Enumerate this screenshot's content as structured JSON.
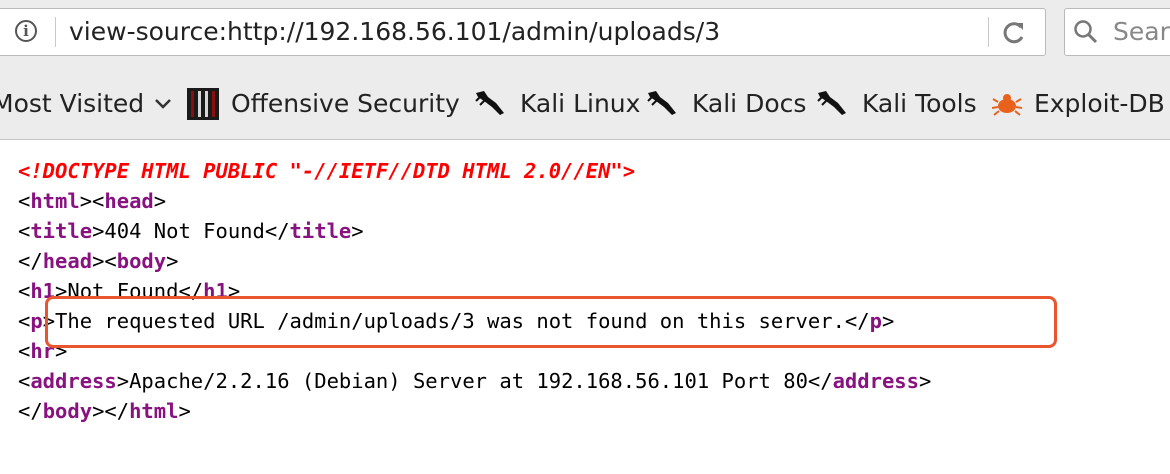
{
  "address_bar": {
    "url": "view-source:http://192.168.56.101/admin/uploads/3",
    "info_icon": "info-icon",
    "reload_icon": "reload-icon"
  },
  "search_bar": {
    "placeholder": "Sear",
    "icon": "search-icon"
  },
  "bookmarks": [
    {
      "label": "Most Visited",
      "icon": "chevron-down-icon"
    },
    {
      "label": "Offensive Security",
      "icon": "offsec-logo-icon"
    },
    {
      "label": "Kali Linux",
      "icon": "kali-dragon-icon"
    },
    {
      "label": "Kali Docs",
      "icon": "kali-dragon-icon"
    },
    {
      "label": "Kali Tools",
      "icon": "kali-dragon-icon"
    },
    {
      "label": "Exploit-DB",
      "icon": "exploitdb-bug-icon"
    }
  ],
  "source": {
    "doctype": "<!DOCTYPE HTML PUBLIC \"-//IETF//DTD HTML 2.0//EN\">",
    "tags": {
      "html": "html",
      "head": "head",
      "title": "title",
      "body": "body",
      "h1": "h1",
      "p": "p",
      "hr": "hr",
      "address": "address"
    },
    "title_text": "404 Not Found",
    "h1_text": "Not Found",
    "p_text": "The requested URL /admin/uploads/3 was not found on this server.",
    "address_text": "Apache/2.2.16 (Debian) Server at 192.168.56.101 Port 80"
  },
  "colors": {
    "doctype": "#ff0000",
    "tag": "#881280",
    "highlight": "#e8552f"
  }
}
